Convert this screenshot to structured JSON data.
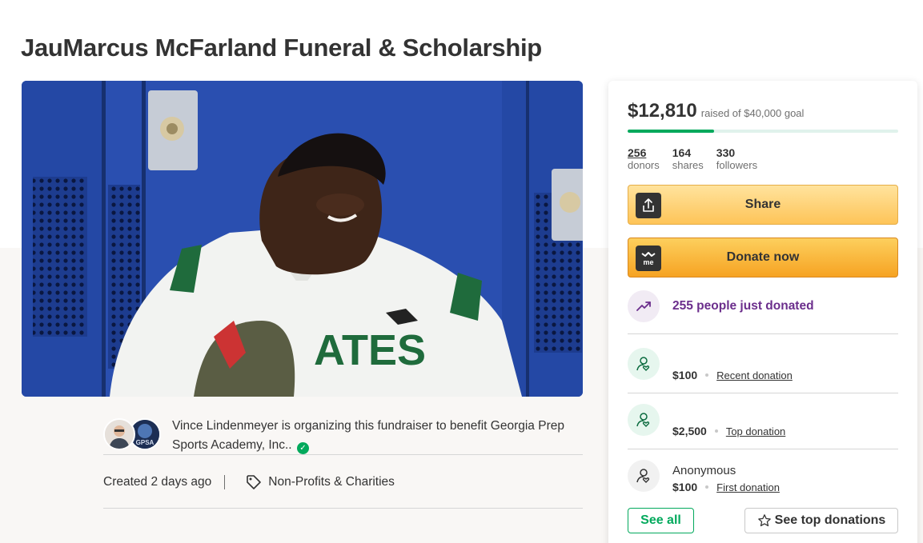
{
  "page": {
    "title": "JauMarcus McFarland Funeral & Scholarship"
  },
  "hero": {
    "jersey_text": "ATES"
  },
  "organizer": {
    "text": "Vince Lindenmeyer is organizing this fundraiser to benefit Georgia Prep Sports Academy, Inc..",
    "org_avatar_text": "GPSA",
    "verified_icon": "check-circle-icon"
  },
  "meta": {
    "created": "Created 2 days ago",
    "category": "Non-Profits & Charities",
    "category_icon": "tag-icon"
  },
  "donation_card": {
    "raised_amount": "$12,810",
    "goal_text": "raised of $40,000 goal",
    "progress_fraction": 0.32,
    "stats": [
      {
        "value": "256",
        "label": "donors"
      },
      {
        "value": "164",
        "label": "shares"
      },
      {
        "value": "330",
        "label": "followers"
      }
    ],
    "share_label": "Share",
    "donate_label": "Donate now",
    "donate_icon_text": "me",
    "trend_text": "255 people just donated",
    "recent": {
      "amount": "$100",
      "kind": "Recent donation"
    },
    "top": {
      "amount": "$2,500",
      "kind": "Top donation"
    },
    "first": {
      "name": "Anonymous",
      "amount": "$100",
      "kind": "First donation"
    },
    "see_all_label": "See all",
    "see_top_label": "See top donations"
  },
  "colors": {
    "green": "#02a95c",
    "purple": "#6b2e8c",
    "share_yellow": "#fec458",
    "donate_orange": "#f6a323"
  }
}
